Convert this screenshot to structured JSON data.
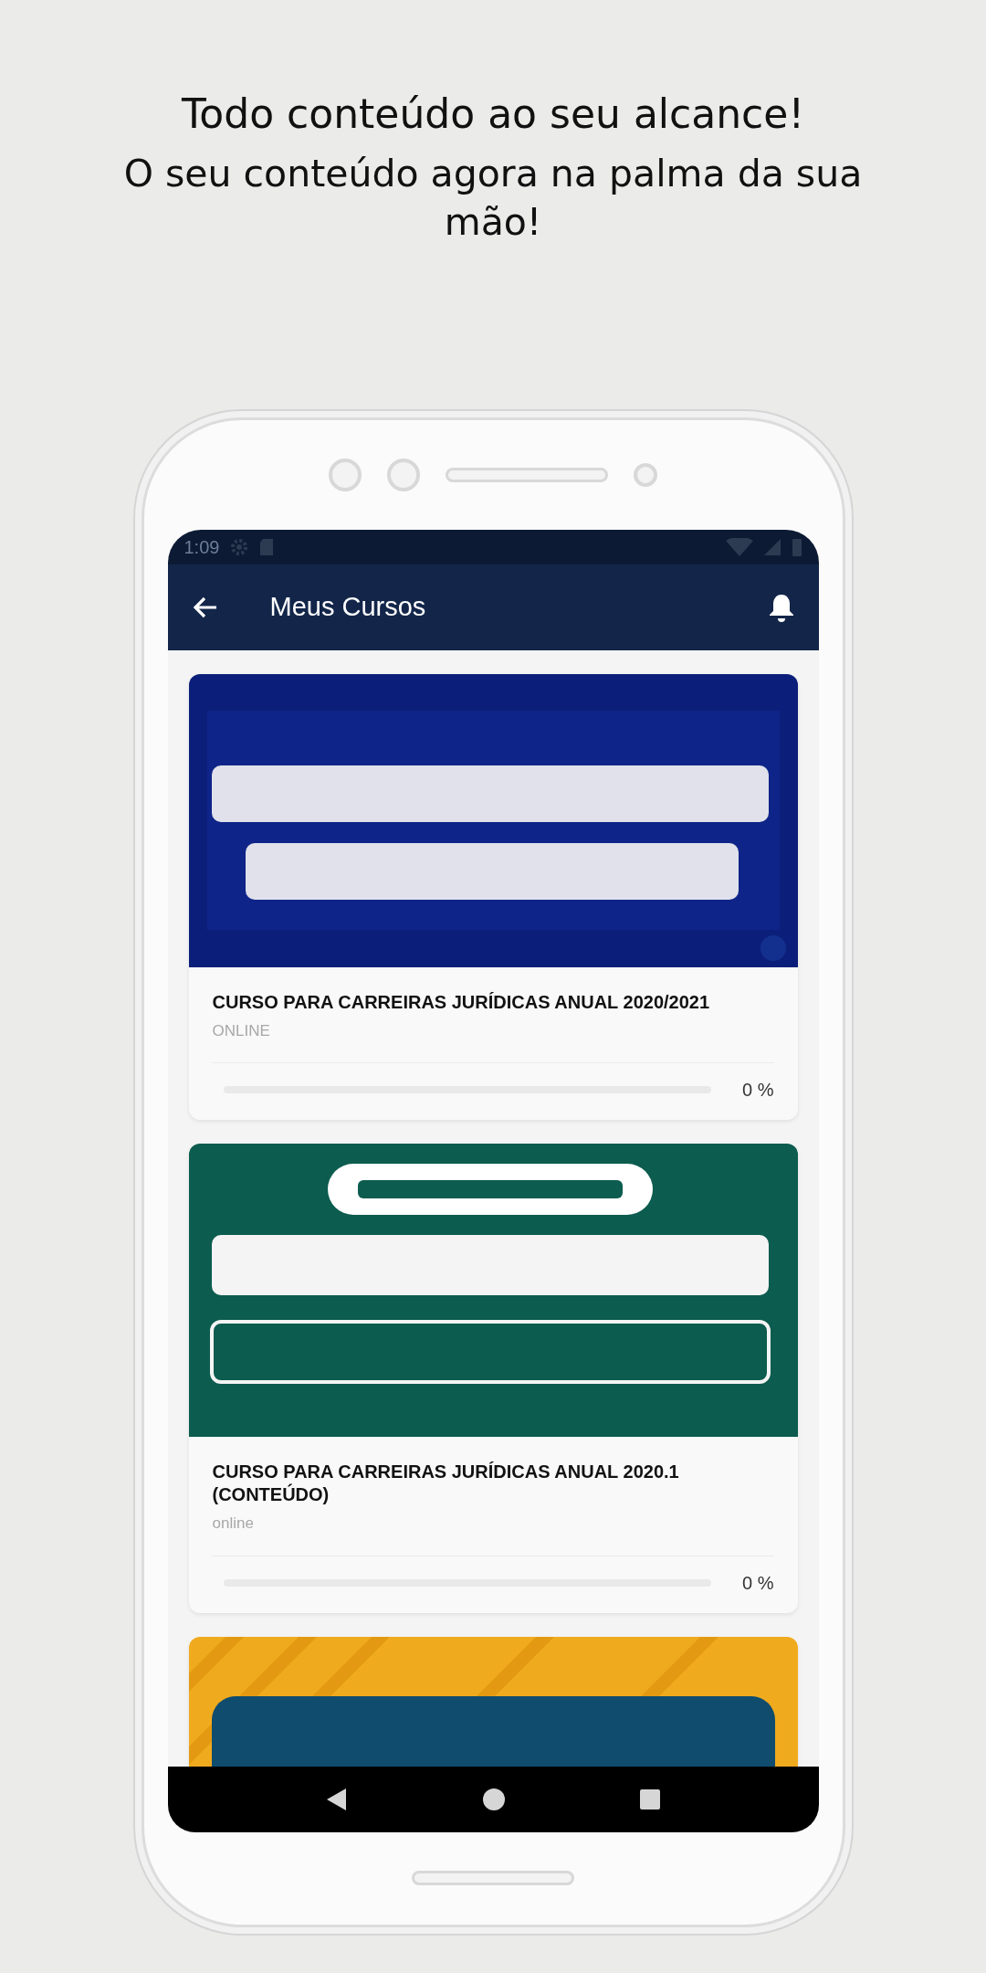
{
  "headline": {
    "title": "Todo conteúdo ao seu alcance!",
    "subtitle": "O seu conteúdo agora na palma da sua mão!"
  },
  "status_bar": {
    "time": "1:09"
  },
  "app_bar": {
    "title": "Meus Cursos"
  },
  "courses": [
    {
      "image": {
        "kind": "picture"
      },
      "title": "CURSO PARA CARREIRAS JURÍDICAS ANUAL 2020/2021",
      "modality": "ONLINE",
      "progress": {
        "level": 0,
        "reading": "0 %"
      }
    },
    {
      "image": {
        "kind": "picture"
      },
      "title": "CURSO PARA CARREIRAS JURÍDICAS ANUAL 2020.1 (CONTEÚDO)",
      "modality": "online",
      "progress": {
        "level": 0,
        "reading": "0 %"
      }
    },
    {
      "image": {
        "kind": "picture"
      }
    }
  ]
}
